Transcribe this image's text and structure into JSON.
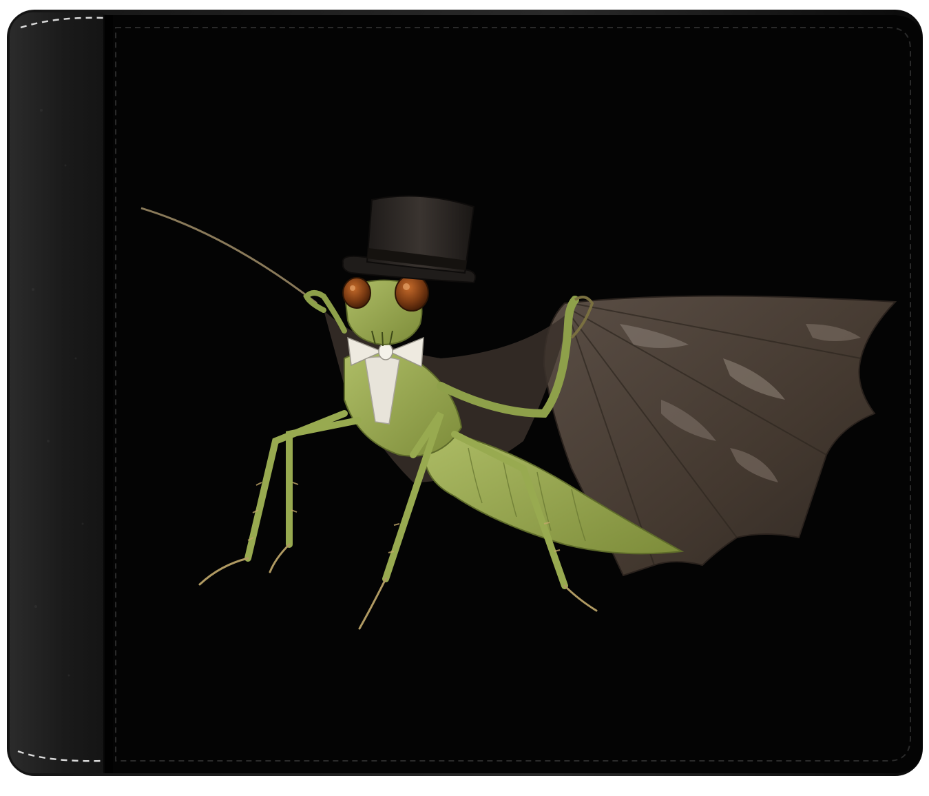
{
  "image": {
    "subject": "bifold-wallet",
    "colors": {
      "background": "#ffffff",
      "leather": "#1c1c1c",
      "leather_highlight": "#3a3a3a",
      "panel": "#050505",
      "stitch_white": "#d9d9d9",
      "stitch_dark": "#2a2a2a",
      "insect_green": "#9bae55",
      "insect_dark": "#6b7a33",
      "hat": "#262220",
      "eye": "#7a3a12",
      "bowtie": "#e8e4da",
      "wing": "#4a3f38",
      "wing_light": "#8d8178"
    },
    "icons": [
      "top-hat-icon",
      "bow-tie-icon",
      "grasshopper-icon",
      "bat-wing-icon"
    ]
  }
}
